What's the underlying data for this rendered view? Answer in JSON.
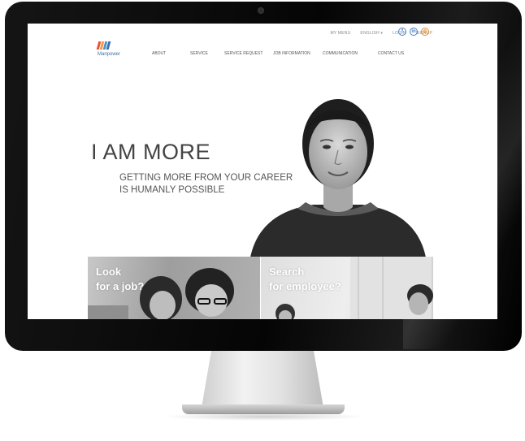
{
  "utility_nav": {
    "items": [
      "MY MENU",
      "ENGLISH ▾",
      "LOGIN",
      "SIGNUP"
    ]
  },
  "social": {
    "facebook": "f",
    "linkedin": "in",
    "instagram": "◎"
  },
  "logo": {
    "text": "Manpower"
  },
  "main_nav": {
    "items": [
      "ABOUT",
      "SERVICE",
      "SERVICE REQUEST",
      "JOB INFORMATION",
      "COMMUNICATION",
      "CONTACT US"
    ]
  },
  "hero": {
    "title": "I AM MORE",
    "subtitle_line1": "GETTING MORE FROM YOUR CAREER",
    "subtitle_line2": "IS HUMANLY POSSIBLE"
  },
  "tiles": {
    "left": {
      "line1": "Look",
      "line2": "for a job?"
    },
    "right": {
      "line1": "Search",
      "line2": "for employee?"
    }
  },
  "colors": {
    "brand_blue": "#3e6fa8",
    "logo_bars": [
      "#e94e3c",
      "#f39c3a",
      "#4a90d9",
      "#3e6fa8"
    ],
    "social_blue": "#4a7fc1",
    "social_orange": "#e08c2a"
  }
}
